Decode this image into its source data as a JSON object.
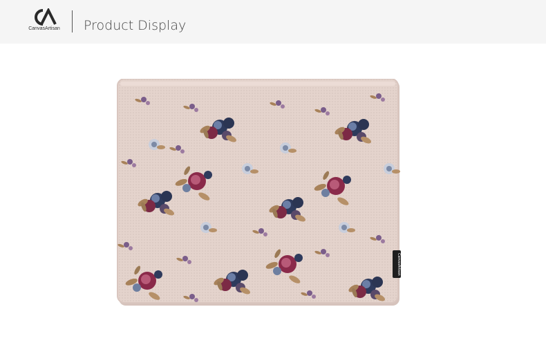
{
  "header": {
    "brand": "CanvasArtisan",
    "logo_icon": "canvasartisan-logo-icon",
    "title": "Product Display"
  },
  "product": {
    "image_icon": "floral-laptop-sleeve",
    "tag_text": "CanvasArtisan",
    "colors": {
      "fabric": "#e4d3cc",
      "accent_rose": "#8a2a4a",
      "accent_blue": "#2e3a5c",
      "leaf": "#a8825a"
    }
  }
}
